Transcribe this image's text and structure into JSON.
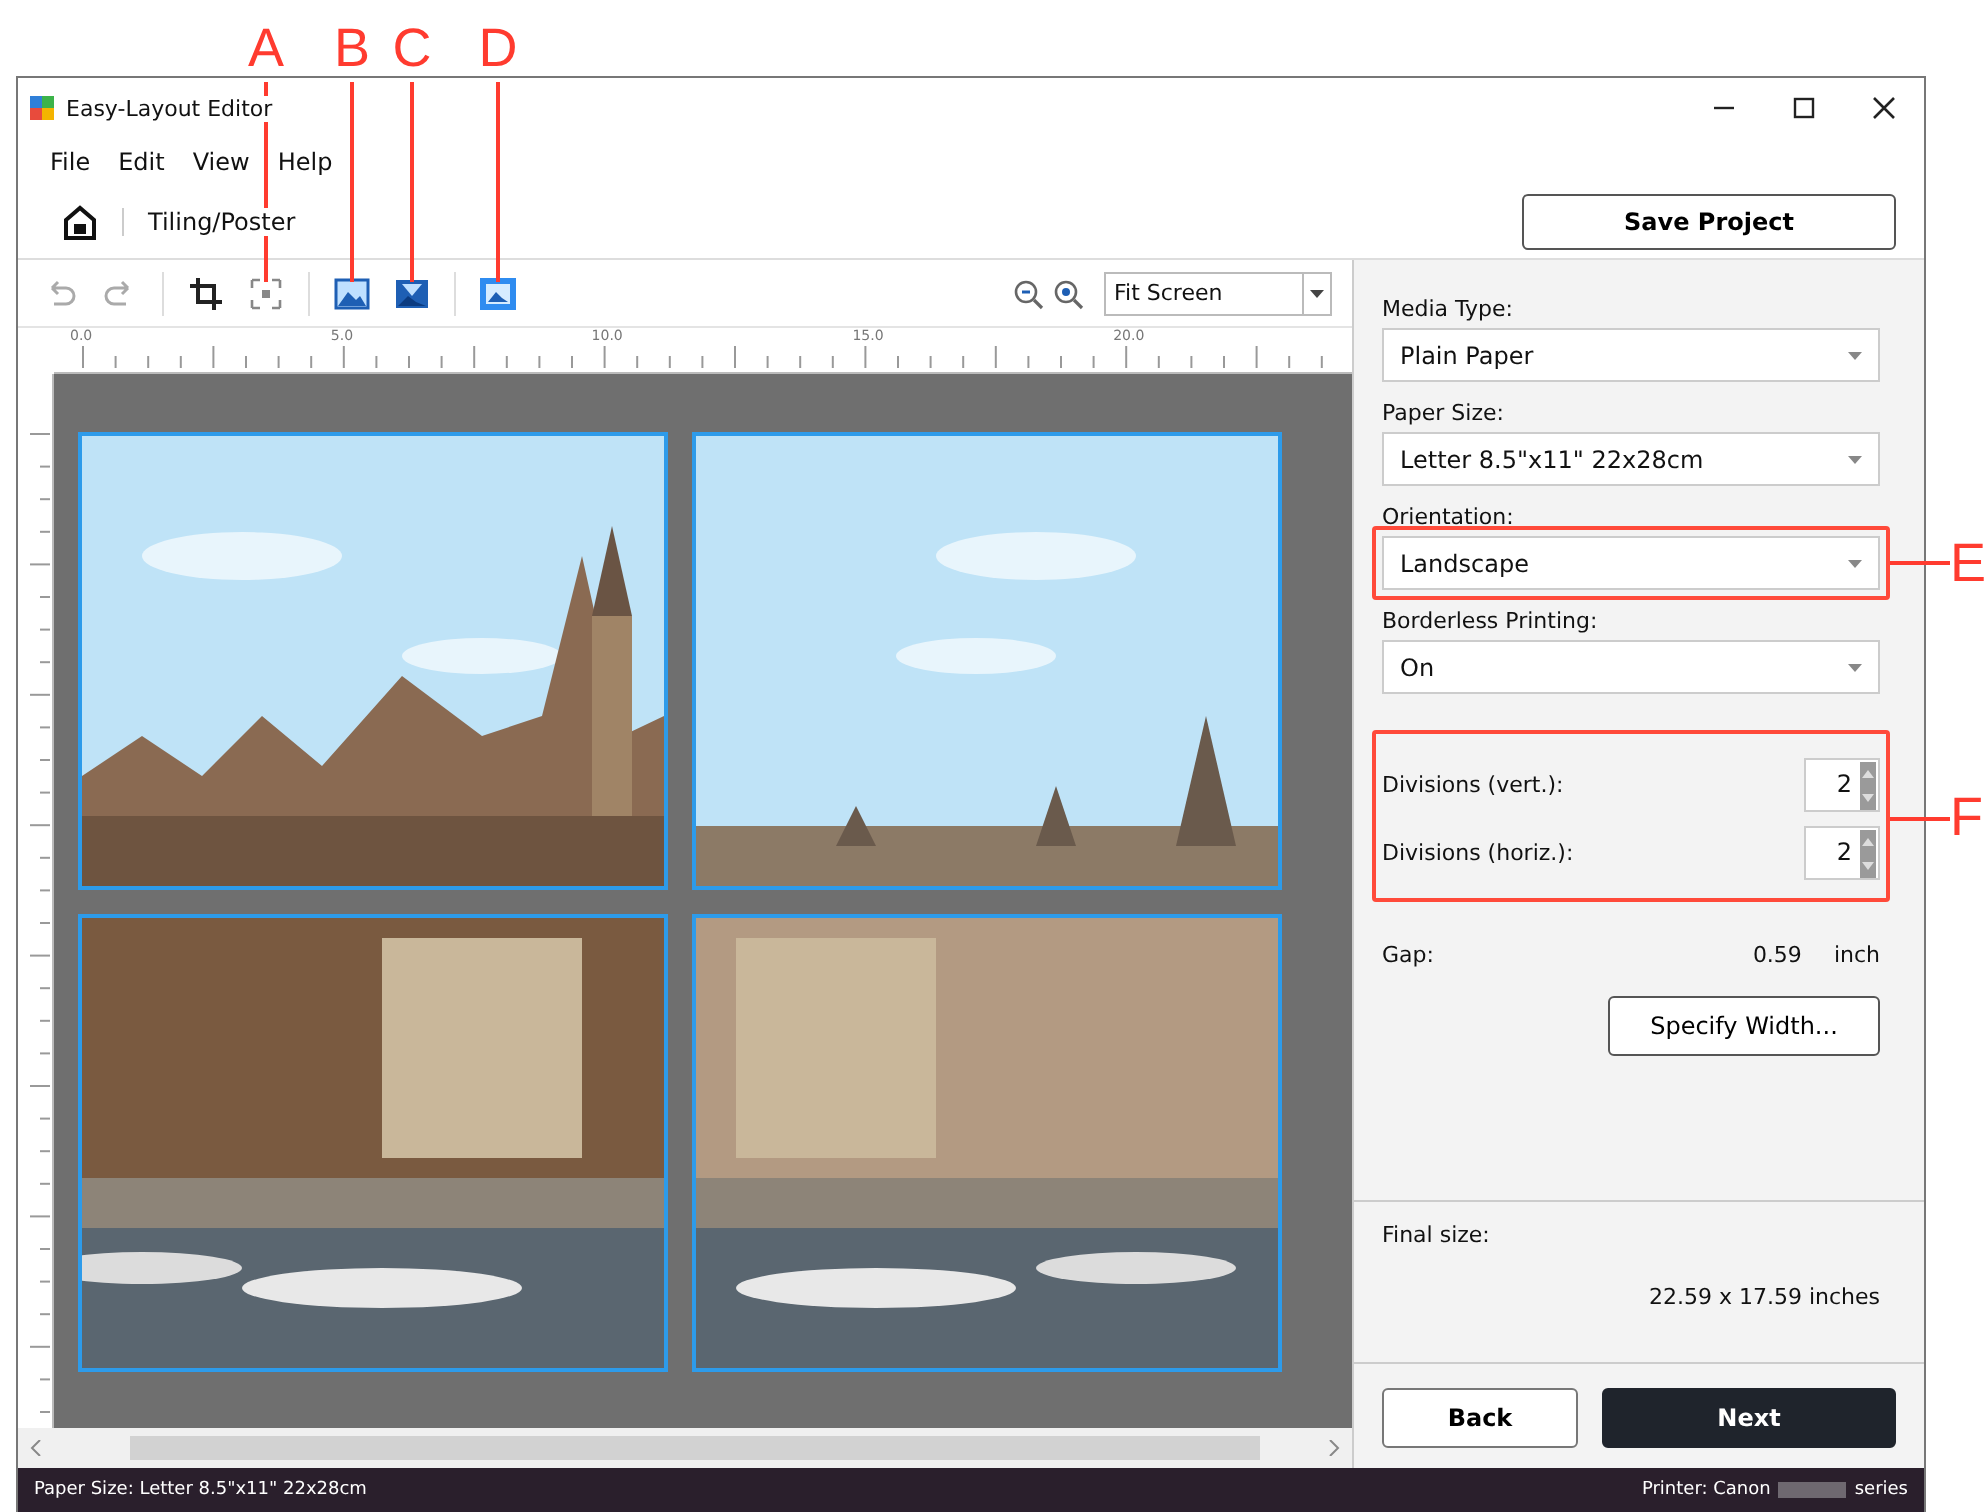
{
  "callouts": [
    {
      "label": "A"
    },
    {
      "label": "B"
    },
    {
      "label": "C"
    },
    {
      "label": "D"
    },
    {
      "label": "E"
    },
    {
      "label": "F"
    }
  ],
  "window": {
    "title": "Easy-Layout Editor"
  },
  "menu": [
    "File",
    "Edit",
    "View",
    "Help"
  ],
  "breadcrumb": "Tiling/Poster",
  "save_button": "Save Project",
  "zoom": {
    "value": "Fit Screen"
  },
  "ruler": {
    "labels": [
      "0.0",
      "5.0",
      "10.0",
      "15.0",
      "20.0"
    ]
  },
  "tiles": [
    {
      "kind": "picture"
    },
    {
      "kind": "picture"
    },
    {
      "kind": "picture"
    },
    {
      "kind": "picture"
    }
  ],
  "settings": [
    {
      "kind": "select",
      "label": "Media Type:",
      "value": "Plain Paper"
    },
    {
      "kind": "select",
      "label": "Paper Size:",
      "value": "Letter 8.5\"x11\" 22x28cm"
    },
    {
      "kind": "select",
      "label": "Orientation:",
      "value": "Landscape"
    },
    {
      "kind": "select",
      "label": "Borderless Printing:",
      "value": "On"
    },
    {
      "kind": "spin",
      "label": "Divisions (vert.):",
      "value": "2"
    },
    {
      "kind": "spin",
      "label": "Divisions (horiz.):",
      "value": "2"
    }
  ],
  "gap": {
    "label": "Gap:",
    "value": "0.59",
    "unit": "inch"
  },
  "specify_button": "Specify Width...",
  "final_size": {
    "label": "Final size:",
    "value": "22.59 x 17.59 inches"
  },
  "buttons": [
    {
      "label": "Back",
      "kind": "secondary"
    },
    {
      "label": "Next",
      "kind": "primary"
    }
  ],
  "status_bar": {
    "paper": "Paper Size: Letter 8.5\"x11\" 22x28cm",
    "printer": "Printer: Canon",
    "printer_suffix": "series"
  }
}
